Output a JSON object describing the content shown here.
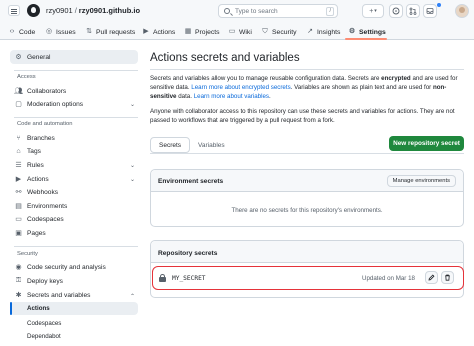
{
  "header": {
    "owner": "rzy0901",
    "separator": "/",
    "repo": "rzy0901.github.io",
    "search_placeholder": "Type  to search",
    "search_key": "/",
    "plus_label": "+",
    "plus_caret": "▾"
  },
  "repo_nav": {
    "tabs": [
      {
        "label": "Code",
        "icon": "code-icon"
      },
      {
        "label": "Issues",
        "icon": "issue-icon"
      },
      {
        "label": "Pull requests",
        "icon": "pull-request-icon"
      },
      {
        "label": "Actions",
        "icon": "play-icon"
      },
      {
        "label": "Projects",
        "icon": "table-icon"
      },
      {
        "label": "Wiki",
        "icon": "book-icon"
      },
      {
        "label": "Security",
        "icon": "shield-icon"
      },
      {
        "label": "Insights",
        "icon": "graph-icon"
      },
      {
        "label": "Settings",
        "icon": "gear-icon",
        "active": true
      }
    ]
  },
  "sidebar": {
    "general": "General",
    "access_heading": "Access",
    "collaborators": "Collaborators",
    "moderation": "Moderation options",
    "code_heading": "Code and automation",
    "branches": "Branches",
    "tags": "Tags",
    "rules": "Rules",
    "actions": "Actions",
    "webhooks": "Webhooks",
    "environments": "Environments",
    "codespaces": "Codespaces",
    "pages": "Pages",
    "security_heading": "Security",
    "code_security": "Code security and analysis",
    "deploy_keys": "Deploy keys",
    "secrets_vars": "Secrets and variables",
    "sub_actions": "Actions",
    "sub_codespaces": "Codespaces",
    "sub_dependabot": "Dependabot"
  },
  "main": {
    "title": "Actions secrets and variables",
    "p1_a": "Secrets and variables allow you to manage reusable configuration data. Secrets are ",
    "p1_b": "encrypted",
    "p1_c": " and are used for sensitive data. ",
    "p1_link1": "Learn more about encrypted secrets",
    "p1_d": ". Variables are shown as plain text and are used for ",
    "p1_e": "non-sensitive",
    "p1_f": " data. ",
    "p1_link2": "Learn more about variables",
    "p1_g": ".",
    "p2": "Anyone with collaborator access to this repository can use these secrets and variables for actions. They are not passed to workflows that are triggered by a pull request from a fork.",
    "tab_secrets": "Secrets",
    "tab_variables": "Variables",
    "new_secret_button": "New repository secret",
    "env_title": "Environment secrets",
    "manage_env_button": "Manage environments",
    "env_empty": "There are no secrets for this repository's environments.",
    "repo_secrets_title": "Repository secrets",
    "secret_name": "MY_SECRET",
    "secret_updated": "Updated on Mar 18"
  },
  "colors": {
    "primary_green": "#1f883d",
    "link_blue": "#0969da",
    "highlight_red": "#e5333a",
    "active_tab": "#fd8c73"
  }
}
